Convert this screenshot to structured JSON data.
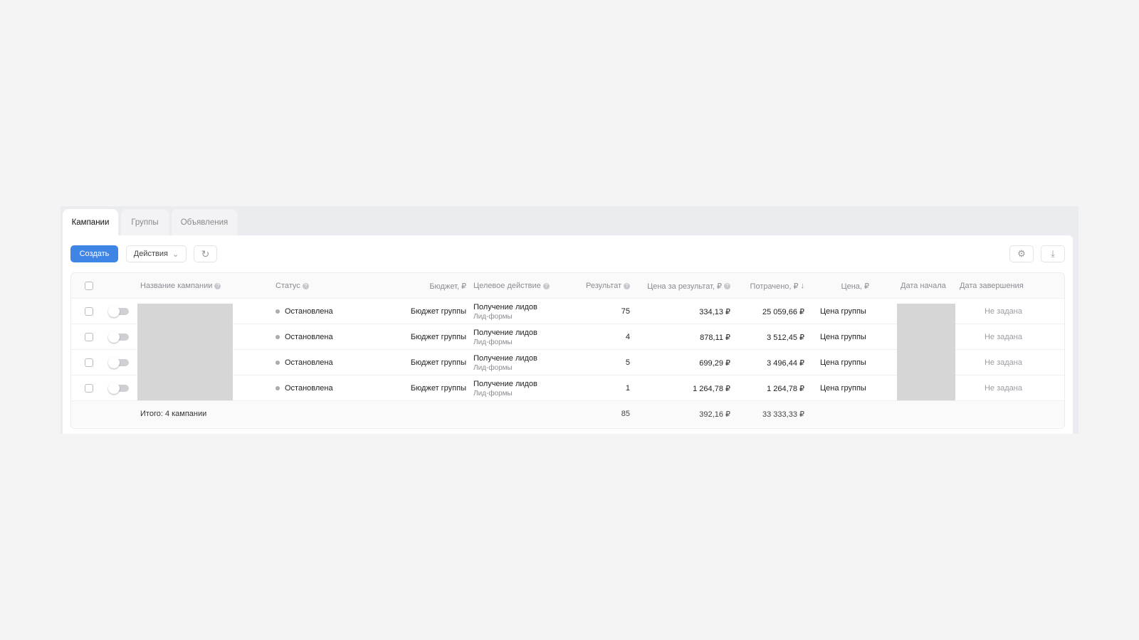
{
  "tabs": [
    {
      "label": "Кампании",
      "active": true
    },
    {
      "label": "Группы"
    },
    {
      "label": "Объявления"
    }
  ],
  "toolbar": {
    "create": "Создать",
    "actions": "Действия",
    "refresh_icon": "refresh-icon",
    "settings_icon": "gear-icon",
    "download_icon": "download-icon"
  },
  "columns": {
    "name": "Название кампании",
    "status": "Статус",
    "budget": "Бюджет, ₽",
    "target": "Целевое действие",
    "result": "Результат",
    "cpr": "Цена за результат, ₽",
    "spent": "Потрачено, ₽",
    "spent_sort": "↓",
    "price": "Цена, ₽",
    "start": "Дата начала",
    "end": "Дата завершения"
  },
  "rows": [
    {
      "status": "Остановлена",
      "budget": "Бюджет группы",
      "target": "Получение лидов",
      "target_sub": "Лид-формы",
      "result": "75",
      "cpr": "334,13 ₽",
      "spent": "25 059,66 ₽",
      "price": "Цена группы",
      "end": "Не задана"
    },
    {
      "status": "Остановлена",
      "budget": "Бюджет группы",
      "target": "Получение лидов",
      "target_sub": "Лид-формы",
      "result": "4",
      "cpr": "878,11 ₽",
      "spent": "3 512,45 ₽",
      "price": "Цена группы",
      "end": "Не задана"
    },
    {
      "status": "Остановлена",
      "budget": "Бюджет группы",
      "target": "Получение лидов",
      "target_sub": "Лид-формы",
      "result": "5",
      "cpr": "699,29 ₽",
      "spent": "3 496,44 ₽",
      "price": "Цена группы",
      "end": "Не задана"
    },
    {
      "status": "Остановлена",
      "budget": "Бюджет группы",
      "target": "Получение лидов",
      "target_sub": "Лид-формы",
      "result": "1",
      "cpr": "1 264,78 ₽",
      "spent": "1 264,78 ₽",
      "price": "Цена группы",
      "end": "Не задана"
    }
  ],
  "total": {
    "label": "Итого: 4 кампании",
    "result": "85",
    "cpr": "392,16 ₽",
    "spent": "33 333,33 ₽"
  }
}
